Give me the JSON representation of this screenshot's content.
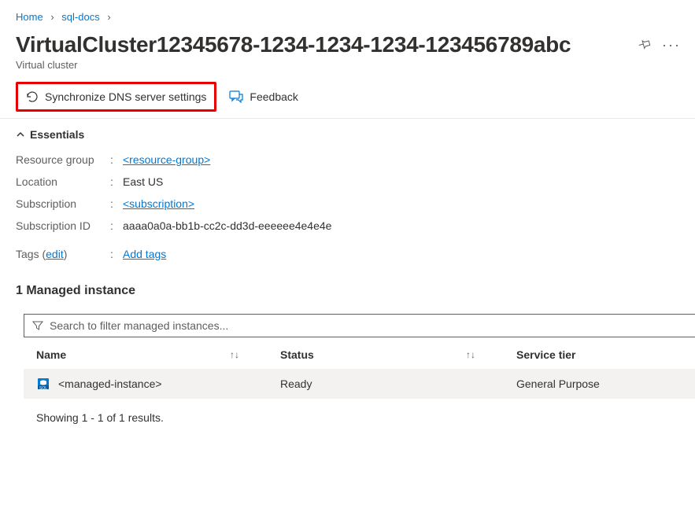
{
  "breadcrumb": {
    "home": "Home",
    "docs": "sql-docs"
  },
  "header": {
    "title": "VirtualCluster12345678-1234-1234-1234-123456789abc",
    "subtitle": "Virtual cluster"
  },
  "toolbar": {
    "sync": "Synchronize DNS server settings",
    "feedback": "Feedback"
  },
  "essentials": {
    "label": "Essentials",
    "rows": {
      "resource_group_label": "Resource group",
      "resource_group_value": "<resource-group>",
      "location_label": "Location",
      "location_value": "East US",
      "subscription_label": "Subscription",
      "subscription_value": "<subscription>",
      "subscription_id_label": "Subscription ID",
      "subscription_id_value": "aaaa0a0a-bb1b-cc2c-dd3d-eeeeee4e4e4e",
      "tags_label": "Tags",
      "tags_edit": "edit",
      "tags_value": "Add tags"
    }
  },
  "managed_instance": {
    "section_title": "1 Managed instance",
    "search_placeholder": "Search to filter managed instances...",
    "columns": {
      "name": "Name",
      "status": "Status",
      "tier": "Service tier"
    },
    "rows": [
      {
        "name": "<managed-instance>",
        "status": "Ready",
        "tier": "General Purpose"
      }
    ],
    "results_text": "Showing 1 - 1 of 1 results."
  }
}
